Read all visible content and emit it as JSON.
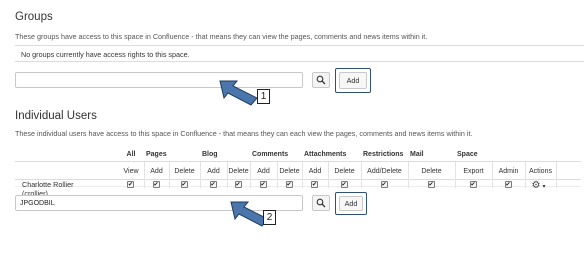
{
  "groups": {
    "title": "Groups",
    "description": "These groups have access to this space in Confluence - that means they can view the pages, comments and news items within it.",
    "empty_message": "No groups currently have access rights to this space.",
    "input_value": "",
    "add_label": "Add",
    "callout": "1"
  },
  "users": {
    "title": "Individual Users",
    "description": "These individual users have access to this space in Confluence - that means they can each view the pages, comments and news items within it.",
    "input_value": "JPGODBIL",
    "add_label": "Add",
    "callout": "2"
  },
  "table": {
    "groups_header": [
      "All",
      "Pages",
      "Blog",
      "Comments",
      "Attachments",
      "Restrictions",
      "Mail",
      "Space"
    ],
    "sub_header": [
      "View",
      "Add",
      "Delete",
      "Add",
      "Delete",
      "Add",
      "Delete",
      "Add",
      "Delete",
      "Add/Delete",
      "Delete",
      "Export",
      "Admin",
      "Actions"
    ],
    "rows": [
      {
        "name": "Charlotte Rollier",
        "username": "(crollier)",
        "permissions": [
          true,
          true,
          true,
          true,
          true,
          true,
          true,
          true,
          true,
          true,
          true,
          true,
          true
        ]
      }
    ]
  },
  "icons": {
    "search": "search-icon",
    "actions": "gear-icon",
    "callout_arrow": "callout-arrow-icon"
  },
  "colors": {
    "highlight_border": "#2e4f76",
    "arrow_fill": "#4a76ac"
  }
}
